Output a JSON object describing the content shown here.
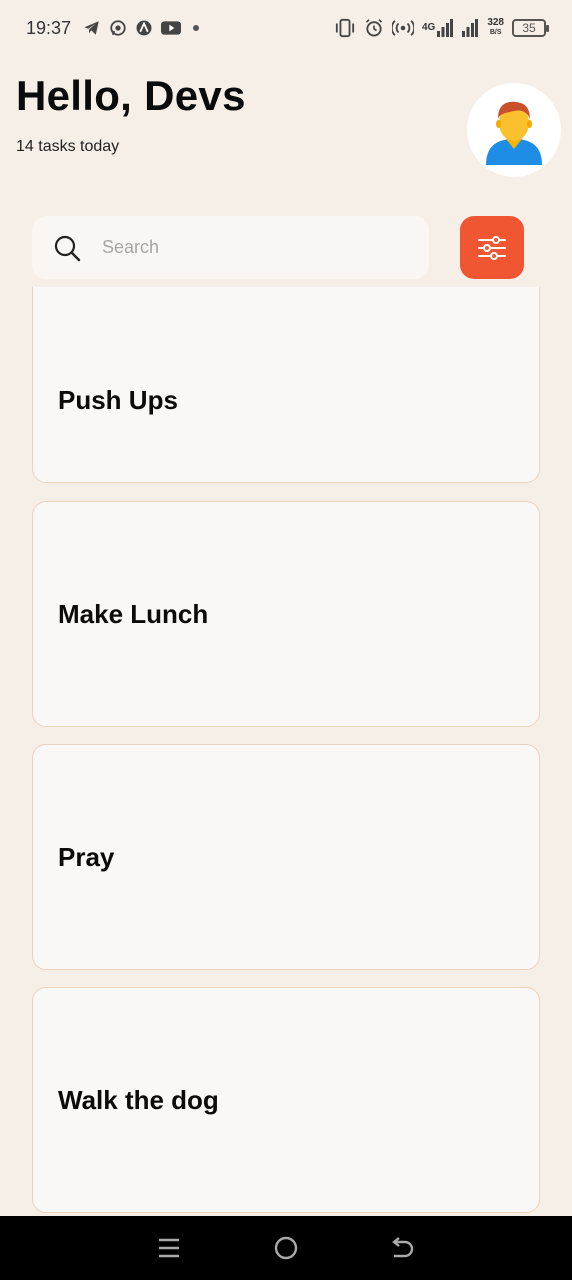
{
  "status_bar": {
    "time": "19:37",
    "left_icons": [
      "telegram-icon",
      "whatsapp-icon",
      "app-icon",
      "youtube-icon",
      "dot-icon"
    ],
    "network_4g": "4G",
    "speed_value": "328",
    "speed_unit": "B/S",
    "battery": "35"
  },
  "header": {
    "greeting": "Hello, Devs",
    "subtitle": "14 tasks today"
  },
  "search": {
    "placeholder": "Search"
  },
  "tasks": [
    {
      "title": "Push Ups"
    },
    {
      "title": "Make Lunch"
    },
    {
      "title": "Pray"
    },
    {
      "title": "Walk the dog"
    }
  ],
  "colors": {
    "background": "#f6efe8",
    "accent": "#ef5631",
    "card_border": "#ead2bd"
  }
}
